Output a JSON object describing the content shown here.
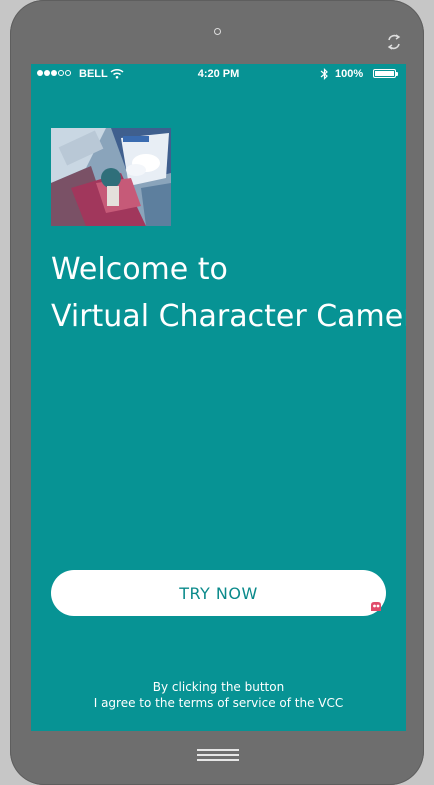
{
  "status_bar": {
    "carrier": "BELL",
    "time": "4:20 PM",
    "battery": "100%",
    "signal_bars_full": 3,
    "signal_bars_total": 5
  },
  "welcome": {
    "line1": "Welcome to",
    "line2": "Virtual Character Camera"
  },
  "try_button": {
    "label": "TRY NOW"
  },
  "terms": {
    "line1": "By clicking the button",
    "line2": "I agree to the terms of service of the VCC"
  },
  "colors": {
    "screen_bg": "#079394",
    "button_text": "#0b8a8b",
    "bezel": "#6e6e6e"
  },
  "icons": [
    "rotate-icon",
    "wifi-icon",
    "bluetooth-icon",
    "battery-icon",
    "badge-icon",
    "home-button"
  ]
}
